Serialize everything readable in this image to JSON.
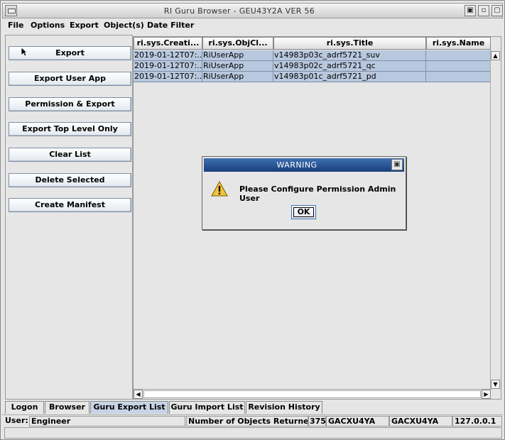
{
  "window": {
    "title": "RI Guru Browser - GEU43Y2A  VER 56",
    "controls": {
      "maximize": "▣",
      "minimize": "▫",
      "close": "▢"
    }
  },
  "menu": [
    "File",
    "Options",
    "Export",
    "Object(s)",
    "Date Filter"
  ],
  "left_buttons": [
    "Export",
    "Export User App",
    "Permission & Export",
    "Export Top Level Only",
    "Clear List",
    "Delete Selected",
    "Create Manifest"
  ],
  "table": {
    "columns": [
      "ri.sys.Creati...",
      "ri.sys.ObjCl...",
      "ri.sys.Title",
      "ri.sys.Name"
    ],
    "rows": [
      [
        "2019-01-12T07:...",
        "RiUserApp",
        "v14983p03c_adrf5721_suv",
        ""
      ],
      [
        "2019-01-12T07:...",
        "RiUserApp",
        "v14983p02c_adrf5721_qc",
        ""
      ],
      [
        "2019-01-12T07:...",
        "RiUserApp",
        "v14983p01c_adrf5721_pd",
        ""
      ]
    ]
  },
  "dialog": {
    "title": "WARNING",
    "message": "Please Configure Permission Admin User",
    "ok_label": "OK"
  },
  "tabs": [
    "Logon",
    "Browser",
    "Guru Export List",
    "Guru Import List",
    "Revision History"
  ],
  "active_tab": "Guru Export List",
  "status": {
    "user_label": "User:",
    "user_value": "Engineer",
    "objects_label": "Number of Objects Returned =",
    "objects_count": "375",
    "server1": "GACXU4YA",
    "server2": "GACXU4YA",
    "ip": "127.0.0.1"
  },
  "colors": {
    "selection": "#b8c8de",
    "dialog_title": "#1a3f7c",
    "active_tab": "#c7d4e6"
  }
}
